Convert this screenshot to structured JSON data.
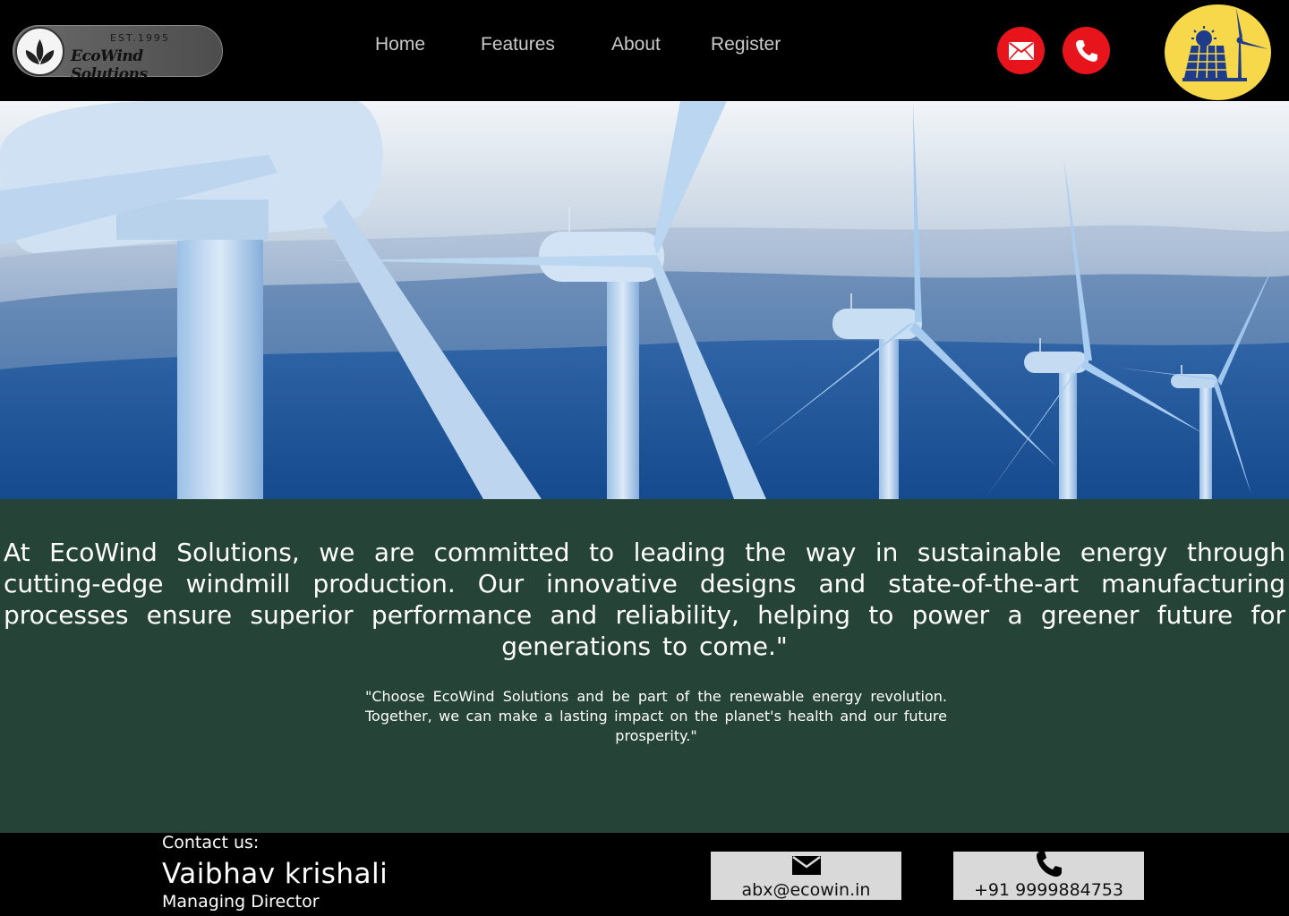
{
  "brand": {
    "est": "EST.1995",
    "name": "EcoWind Solutions",
    "badge_color": "#f6d84a"
  },
  "nav": {
    "items": [
      {
        "label": "Home"
      },
      {
        "label": "Features"
      },
      {
        "label": "About"
      },
      {
        "label": "Register"
      }
    ]
  },
  "header_actions": {
    "email_icon": "mail-icon",
    "phone_icon": "phone-icon",
    "accent": "#e8141b"
  },
  "hero": {
    "image": "wind-turbines-photo"
  },
  "about": {
    "mission": "At EcoWind Solutions, we are committed to leading the way in sustainable energy through cutting-edge windmill production. Our innovative designs and state-of-the-art manufacturing processes ensure superior performance and reliability, helping to power a greener future for generations to come.\"",
    "quote": "\"Choose EcoWind Solutions and be part of the renewable energy revolution. Together, we can make a lasting impact on the planet's health and our future prosperity.\"",
    "background": "#264337"
  },
  "footer": {
    "contact_label": "Contact us:",
    "name": "Vaibhav krishali",
    "role": "Managing Director",
    "email": "abx@ecowin.in",
    "phone": "+91 9999884753"
  }
}
